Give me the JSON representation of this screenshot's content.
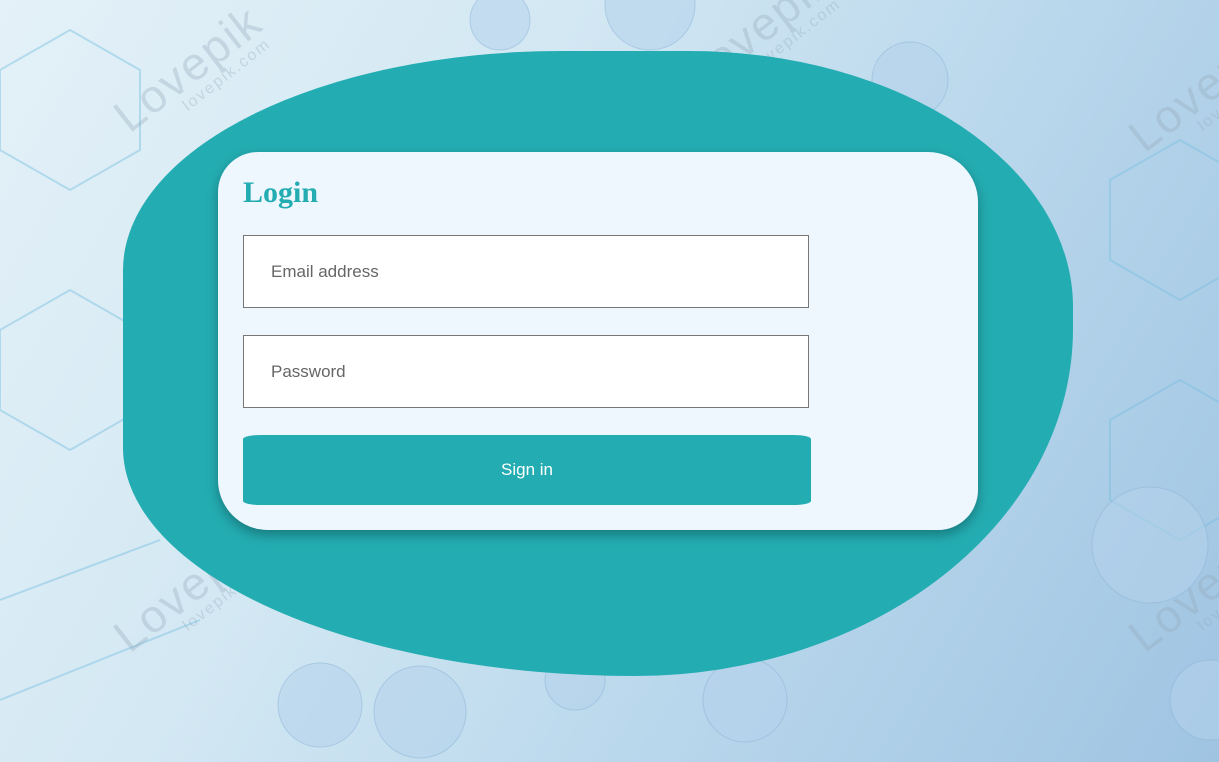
{
  "login": {
    "title": "Login",
    "email_placeholder": "Email address",
    "password_placeholder": "Password",
    "signin_label": "Sign in"
  },
  "background": {
    "watermark_brand": "Lovepik",
    "watermark_domain": "lovepik.com"
  },
  "colors": {
    "accent": "#23adb2",
    "card": "#eef6fe",
    "button_text": "#ffffff"
  }
}
